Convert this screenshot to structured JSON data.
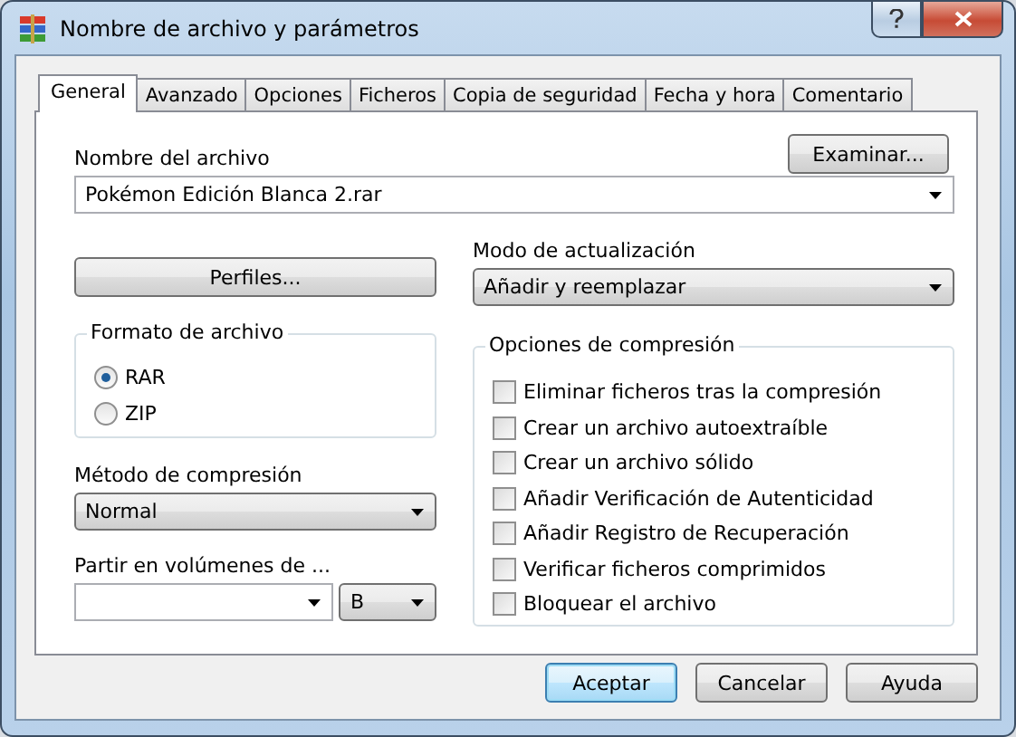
{
  "window": {
    "title": "Nombre de archivo y parámetros"
  },
  "tabs": [
    {
      "label": "General",
      "selected": true
    },
    {
      "label": "Avanzado",
      "selected": false
    },
    {
      "label": "Opciones",
      "selected": false
    },
    {
      "label": "Ficheros",
      "selected": false
    },
    {
      "label": "Copia de seguridad",
      "selected": false
    },
    {
      "label": "Fecha y hora",
      "selected": false
    },
    {
      "label": "Comentario",
      "selected": false
    }
  ],
  "file_name": {
    "label": "Nombre del archivo",
    "value": "Pokémon Edición Blanca 2.rar",
    "browse_button": "Examinar..."
  },
  "profiles_button": "Perfiles...",
  "update_mode": {
    "label": "Modo de actualización",
    "value": "Añadir y reemplazar"
  },
  "archive_format": {
    "title": "Formato de archivo",
    "options": [
      {
        "label": "RAR",
        "selected": true
      },
      {
        "label": "ZIP",
        "selected": false
      }
    ]
  },
  "compression_method": {
    "label": "Método de compresión",
    "value": "Normal"
  },
  "split_volumes": {
    "label": "Partir en volúmenes de ...",
    "unit": "B"
  },
  "compression_options": {
    "title": "Opciones de compresión",
    "items": [
      {
        "label": "Eliminar ficheros tras la compresión",
        "checked": false
      },
      {
        "label": "Crear un archivo autoextraíble",
        "checked": false
      },
      {
        "label": "Crear un archivo sólido",
        "checked": false
      },
      {
        "label": "Añadir Verificación de Autenticidad",
        "checked": false
      },
      {
        "label": "Añadir Registro de Recuperación",
        "checked": false
      },
      {
        "label": "Verificar ficheros comprimidos",
        "checked": false
      },
      {
        "label": "Bloquear el archivo",
        "checked": false
      }
    ]
  },
  "buttons": [
    {
      "label": "Aceptar",
      "default": true
    },
    {
      "label": "Cancelar",
      "default": false
    },
    {
      "label": "Ayuda",
      "default": false
    }
  ]
}
